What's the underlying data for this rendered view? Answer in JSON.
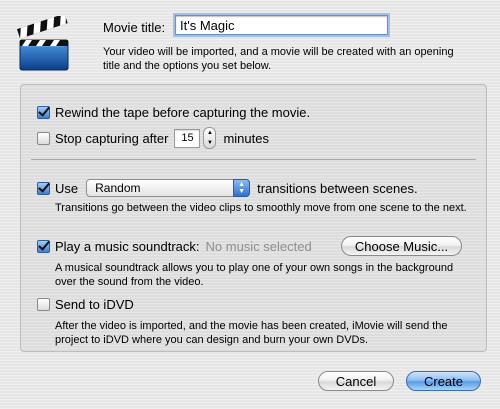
{
  "header": {
    "movie_title_label": "Movie title:",
    "movie_title_value": "It's Magic",
    "intro_text": "Your video will be imported, and a movie will be created with an opening title and the options you set below."
  },
  "options": {
    "rewind": {
      "label": "Rewind the tape before capturing the movie.",
      "checked": true
    },
    "stop_capturing": {
      "label_before": "Stop capturing after",
      "minutes": "15",
      "label_after": "minutes",
      "checked": false
    },
    "transitions": {
      "use_label": "Use",
      "selected": "Random",
      "label_after": "transitions between scenes.",
      "checked": true,
      "description": "Transitions go between the video clips to smoothly move from one scene to the next."
    },
    "soundtrack": {
      "label": "Play a music soundtrack:",
      "status": "No music selected",
      "choose_button": "Choose Music...",
      "checked": true,
      "description": "A musical soundtrack allows you to play one of your own songs in the background over the sound from the video."
    },
    "idvd": {
      "label": "Send to iDVD",
      "checked": false,
      "description": "After the video is imported, and the movie has been created, iMovie will send the project to iDVD where you can design and burn your own DVDs."
    }
  },
  "buttons": {
    "cancel": "Cancel",
    "create": "Create"
  },
  "colors": {
    "accent": "#3d7ed6",
    "muted_text": "#8e8e8e"
  },
  "icons": {
    "app_icon": "clapperboard-icon"
  }
}
